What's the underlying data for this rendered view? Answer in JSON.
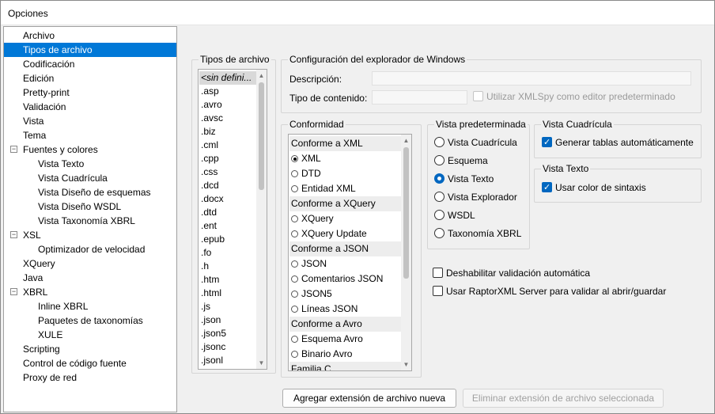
{
  "window": {
    "title": "Opciones"
  },
  "tree": {
    "items": [
      {
        "label": "Archivo"
      },
      {
        "label": "Tipos de archivo"
      },
      {
        "label": "Codificación"
      },
      {
        "label": "Edición"
      },
      {
        "label": "Pretty-print"
      },
      {
        "label": "Validación"
      },
      {
        "label": "Vista"
      },
      {
        "label": "Tema"
      },
      {
        "label": "Fuentes y colores"
      },
      {
        "label": "Vista Texto"
      },
      {
        "label": "Vista Cuadrícula"
      },
      {
        "label": "Vista Diseño de esquemas"
      },
      {
        "label": "Vista Diseño WSDL"
      },
      {
        "label": "Vista Taxonomía XBRL"
      },
      {
        "label": "XSL"
      },
      {
        "label": "Optimizador de velocidad"
      },
      {
        "label": "XQuery"
      },
      {
        "label": "Java"
      },
      {
        "label": "XBRL"
      },
      {
        "label": "Inline XBRL"
      },
      {
        "label": "Paquetes de taxonomías"
      },
      {
        "label": "XULE"
      },
      {
        "label": "Scripting"
      },
      {
        "label": "Control de código fuente"
      },
      {
        "label": "Proxy de red"
      }
    ],
    "expander_symbol": "−"
  },
  "file_types": {
    "title": "Tipos de archivo",
    "items": [
      "<sin defini...",
      ".asp",
      ".avro",
      ".avsc",
      ".biz",
      ".cml",
      ".cpp",
      ".css",
      ".dcd",
      ".docx",
      ".dtd",
      ".ent",
      ".epub",
      ".fo",
      ".h",
      ".htm",
      ".html",
      ".js",
      ".json",
      ".json5",
      ".jsonc",
      ".jsonl"
    ]
  },
  "explorer_config": {
    "title": "Configuración del explorador de Windows",
    "description_label": "Descripción:",
    "content_type_label": "Tipo de contenido:",
    "default_editor_label": "Utilizar XMLSpy como editor predeterminado"
  },
  "conformity": {
    "title": "Conformidad",
    "rows": [
      {
        "type": "header",
        "label": "Conforme a XML"
      },
      {
        "type": "option",
        "label": "XML",
        "selected": true
      },
      {
        "type": "option",
        "label": "DTD"
      },
      {
        "type": "option",
        "label": "Entidad XML"
      },
      {
        "type": "header",
        "label": "Conforme a XQuery"
      },
      {
        "type": "option",
        "label": "XQuery"
      },
      {
        "type": "option",
        "label": "XQuery Update"
      },
      {
        "type": "header",
        "label": "Conforme a JSON"
      },
      {
        "type": "option",
        "label": "JSON"
      },
      {
        "type": "option",
        "label": "Comentarios JSON"
      },
      {
        "type": "option",
        "label": "JSON5"
      },
      {
        "type": "option",
        "label": "Líneas JSON"
      },
      {
        "type": "header",
        "label": "Conforme a Avro"
      },
      {
        "type": "option",
        "label": "Esquema Avro"
      },
      {
        "type": "option",
        "label": "Binario Avro"
      },
      {
        "type": "header",
        "label": "Familia C"
      }
    ]
  },
  "default_view": {
    "title": "Vista predeterminada",
    "options": [
      "Vista Cuadrícula",
      "Esquema",
      "Vista Texto",
      "Vista Explorador",
      "WSDL",
      "Taxonomía XBRL"
    ],
    "selected": "Vista Texto"
  },
  "grid_view": {
    "title": "Vista Cuadrícula",
    "auto_tables_label": "Generar tablas automáticamente"
  },
  "text_view": {
    "title": "Vista Texto",
    "syntax_color_label": "Usar color de sintaxis"
  },
  "options": {
    "disable_auto_validation": "Deshabilitar validación automática",
    "use_raptorxml": "Usar RaptorXML Server para validar al abrir/guardar"
  },
  "buttons": {
    "add_extension": "Agregar extensión de archivo nueva",
    "remove_extension": "Eliminar extensión de archivo seleccionada"
  },
  "colors": {
    "selection": "#0078d7",
    "accent": "#0067c0"
  }
}
